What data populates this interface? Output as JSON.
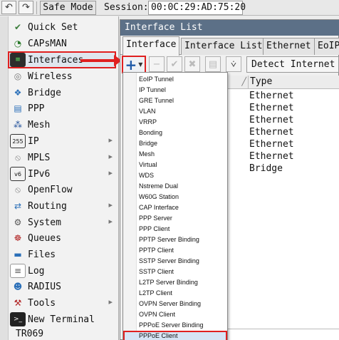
{
  "topbar": {
    "undo_icon": "undo-icon",
    "redo_icon": "redo-icon",
    "safe_mode_label": "Safe Mode",
    "session_label": "Session:",
    "session_value": "00:0C:29:AD:75:20"
  },
  "sidebar": {
    "items": [
      {
        "label": "Quick Set",
        "icon": "quick-set-icon"
      },
      {
        "label": "CAPsMAN",
        "icon": "capsman-icon"
      },
      {
        "label": "Interfaces",
        "icon": "interfaces-icon"
      },
      {
        "label": "Wireless",
        "icon": "wireless-icon"
      },
      {
        "label": "Bridge",
        "icon": "bridge-icon"
      },
      {
        "label": "PPP",
        "icon": "ppp-icon"
      },
      {
        "label": "Mesh",
        "icon": "mesh-icon"
      },
      {
        "label": "IP",
        "icon": "ip-icon"
      },
      {
        "label": "MPLS",
        "icon": "mpls-icon"
      },
      {
        "label": "IPv6",
        "icon": "ipv6-icon"
      },
      {
        "label": "OpenFlow",
        "icon": "openflow-icon"
      },
      {
        "label": "Routing",
        "icon": "routing-icon"
      },
      {
        "label": "System",
        "icon": "system-icon"
      },
      {
        "label": "Queues",
        "icon": "queues-icon"
      },
      {
        "label": "Files",
        "icon": "files-icon"
      },
      {
        "label": "Log",
        "icon": "log-icon"
      },
      {
        "label": "RADIUS",
        "icon": "radius-icon"
      },
      {
        "label": "Tools",
        "icon": "tools-icon"
      },
      {
        "label": "New Terminal",
        "icon": "terminal-icon"
      }
    ],
    "tr069": "TR069"
  },
  "window": {
    "title": "Interface List",
    "tabs": [
      "Interface",
      "Interface List",
      "Ethernet",
      "EoIP"
    ],
    "detect_button": "Detect Internet",
    "table": {
      "type_header": "Type",
      "rows": [
        "Ethernet",
        "Ethernet",
        "Ethernet",
        "Ethernet",
        "Ethernet",
        "Ethernet",
        "Bridge"
      ]
    }
  },
  "dropdown": {
    "items": [
      "EoIP Tunnel",
      "IP Tunnel",
      "GRE Tunnel",
      "VLAN",
      "VRRP",
      "Bonding",
      "Bridge",
      "Mesh",
      "Virtual",
      "WDS",
      "Nstreme Dual",
      "W60G Station",
      "CAP Interface",
      "PPP Server",
      "PPP Client",
      "PPTP Server Binding",
      "PPTP Client",
      "SSTP Server Binding",
      "SSTP Client",
      "L2TP Server Binding",
      "L2TP Client",
      "OVPN Server Binding",
      "OVPN Client",
      "PPPoE Server Binding",
      "PPPoE Client"
    ],
    "selected": "PPPoE Client"
  },
  "colors": {
    "highlight_red": "#e02020",
    "title_bar": "#5c7087",
    "add_plus_blue": "#1f5aa8"
  }
}
